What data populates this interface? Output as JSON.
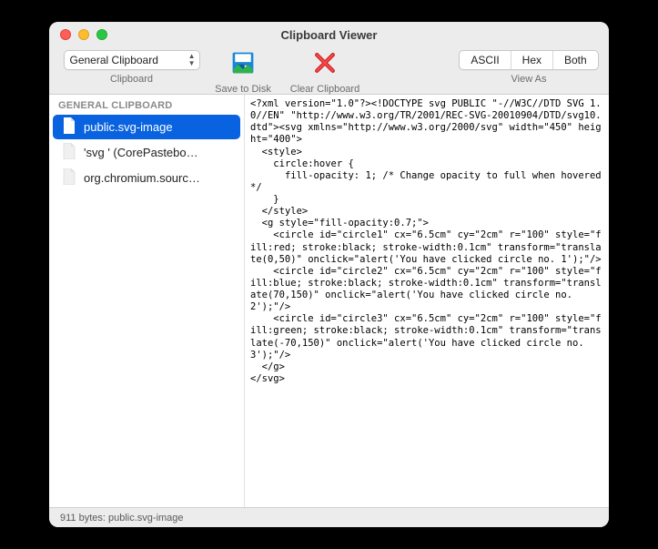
{
  "window": {
    "title": "Clipboard Viewer"
  },
  "toolbar": {
    "clipboard_selector": "General Clipboard",
    "clipboard_label": "Clipboard",
    "save_label": "Save to Disk",
    "clear_label": "Clear Clipboard",
    "view_label": "View As",
    "seg": {
      "ascii": "ASCII",
      "hex": "Hex",
      "both": "Both"
    }
  },
  "sidebar": {
    "header": "GENERAL CLIPBOARD",
    "items": [
      {
        "label": "public.svg-image",
        "selected": true
      },
      {
        "label": "'svg ' (CorePastebo…",
        "selected": false
      },
      {
        "label": "org.chromium.sourc…",
        "selected": false
      }
    ]
  },
  "content": "<?xml version=\"1.0\"?><!DOCTYPE svg PUBLIC \"-//W3C//DTD SVG 1.0//EN\" \"http://www.w3.org/TR/2001/REC-SVG-20010904/DTD/svg10.dtd\"><svg xmlns=\"http://www.w3.org/2000/svg\" width=\"450\" height=\"400\">\n  <style>\n    circle:hover {\n      fill-opacity: 1; /* Change opacity to full when hovered */\n    }\n  </style>\n  <g style=\"fill-opacity:0.7;\">\n    <circle id=\"circle1\" cx=\"6.5cm\" cy=\"2cm\" r=\"100\" style=\"fill:red; stroke:black; stroke-width:0.1cm\" transform=\"translate(0,50)\" onclick=\"alert('You have clicked circle no. 1');\"/>\n    <circle id=\"circle2\" cx=\"6.5cm\" cy=\"2cm\" r=\"100\" style=\"fill:blue; stroke:black; stroke-width:0.1cm\" transform=\"translate(70,150)\" onclick=\"alert('You have clicked circle no. 2');\"/>\n    <circle id=\"circle3\" cx=\"6.5cm\" cy=\"2cm\" r=\"100\" style=\"fill:green; stroke:black; stroke-width:0.1cm\" transform=\"translate(-70,150)\" onclick=\"alert('You have clicked circle no. 3');\"/>\n  </g>\n</svg>",
  "statusbar": {
    "text": "911 bytes: public.svg-image"
  }
}
